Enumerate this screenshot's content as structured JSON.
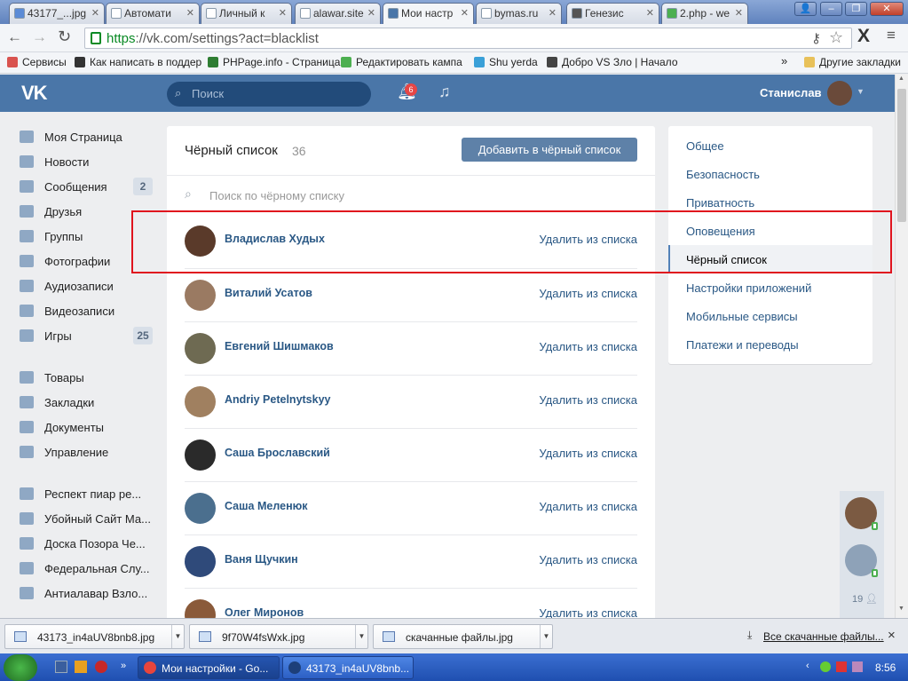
{
  "browser": {
    "tabs": [
      {
        "label": "43177_...jpg",
        "color": "#5b8bd6"
      },
      {
        "label": "Автомати",
        "color": "#ffffff"
      },
      {
        "label": "Личный к",
        "color": "#ffffff"
      },
      {
        "label": "alawar.site",
        "color": "#ffffff"
      },
      {
        "label": "Мои настр",
        "color": "#4a76a8"
      },
      {
        "label": "bymas.ru",
        "color": "#ffffff"
      },
      {
        "label": "Генезис",
        "color": "#555555"
      },
      {
        "label": "2.php - we",
        "color": "#4caf50"
      }
    ],
    "url_scheme": "https",
    "url_rest": "://vk.com/settings?act=blacklist",
    "bookmarks": [
      {
        "label": "Сервисы",
        "color": "#d9534f"
      },
      {
        "label": "Как написать в поддер",
        "color": "#333333"
      },
      {
        "label": "PHPage.info - Страница",
        "color": "#2e7d32"
      },
      {
        "label": "Редактировать кампа",
        "color": "#4caf50"
      },
      {
        "label": "Shu yerda",
        "color": "#3aa0d8"
      },
      {
        "label": "Добро VS Зло | Начало",
        "color": "#444444"
      }
    ],
    "other_bookmarks": "Другие закладки",
    "more": "»"
  },
  "vk_header": {
    "logo": "vk-logo",
    "search_placeholder": "Поиск",
    "notifications_count": "6",
    "user_name": "Станислав"
  },
  "left_menu": {
    "items": [
      {
        "label": "Моя Страница",
        "icon": "home-icon",
        "count": ""
      },
      {
        "label": "Новости",
        "icon": "news-icon",
        "count": ""
      },
      {
        "label": "Сообщения",
        "icon": "messages-icon",
        "count": "2"
      },
      {
        "label": "Друзья",
        "icon": "friends-icon",
        "count": ""
      },
      {
        "label": "Группы",
        "icon": "groups-icon",
        "count": ""
      },
      {
        "label": "Фотографии",
        "icon": "camera-icon",
        "count": ""
      },
      {
        "label": "Аудиозаписи",
        "icon": "music-icon",
        "count": ""
      },
      {
        "label": "Видеозаписи",
        "icon": "video-icon",
        "count": ""
      },
      {
        "label": "Игры",
        "icon": "games-icon",
        "count": "25"
      }
    ],
    "items2": [
      {
        "label": "Товары",
        "icon": "bag-icon"
      },
      {
        "label": "Закладки",
        "icon": "star-icon"
      },
      {
        "label": "Документы",
        "icon": "document-icon"
      },
      {
        "label": "Управление",
        "icon": "gamepad-icon"
      }
    ],
    "groups": [
      {
        "label": "Респект пиар ре..."
      },
      {
        "label": "Убойный Сайт Ма..."
      },
      {
        "label": "Доска Позора Че..."
      },
      {
        "label": "Федеральная Слу..."
      },
      {
        "label": "Антиалавар Взло..."
      }
    ]
  },
  "blacklist": {
    "title": "Чёрный список",
    "count": "36",
    "add_button": "Добавить в чёрный список",
    "search_placeholder": "Поиск по чёрному списку",
    "remove_label": "Удалить из списка",
    "users": [
      {
        "name": "Владислав Худых",
        "color": "#5a3a2a"
      },
      {
        "name": "Виталий Усатов",
        "color": "#9a7a62"
      },
      {
        "name": "Евгений Шишмаков",
        "color": "#6e6a52"
      },
      {
        "name": "Andriy Petelnytskyy",
        "color": "#a08060"
      },
      {
        "name": "Саша Брославский",
        "color": "#2a2a2a"
      },
      {
        "name": "Саша Меленюк",
        "color": "#4b6f8e"
      },
      {
        "name": "Ваня Щучкин",
        "color": "#2f4a7a"
      },
      {
        "name": "Олег Миронов",
        "color": "#8a5a3a"
      }
    ]
  },
  "settings_menu": {
    "items": [
      {
        "label": "Общее",
        "selected": false
      },
      {
        "label": "Безопасность",
        "selected": false
      },
      {
        "label": "Приватность",
        "selected": false
      },
      {
        "label": "Оповещения",
        "selected": false
      },
      {
        "label": "Чёрный список",
        "selected": true
      },
      {
        "label": "Настройки приложений",
        "selected": false
      },
      {
        "label": "Мобильные сервисы",
        "selected": false
      },
      {
        "label": "Платежи и переводы",
        "selected": false
      }
    ]
  },
  "online_friends": {
    "count": "19"
  },
  "downloads": {
    "items": [
      {
        "label": "43173_in4aUV8bnb8.jpg"
      },
      {
        "label": "9f70W4fsWxk.jpg"
      },
      {
        "label": "скачанные файлы.jpg"
      }
    ],
    "all_downloads": "Все скачанные файлы...",
    "close": "×"
  },
  "taskbar": {
    "tasks": [
      {
        "label": "Мои настройки - Go...",
        "color": "#e8453c"
      },
      {
        "label": "43173_in4aUV8bnb...",
        "color": "#1d3f7a"
      }
    ],
    "clock": "8:56"
  }
}
